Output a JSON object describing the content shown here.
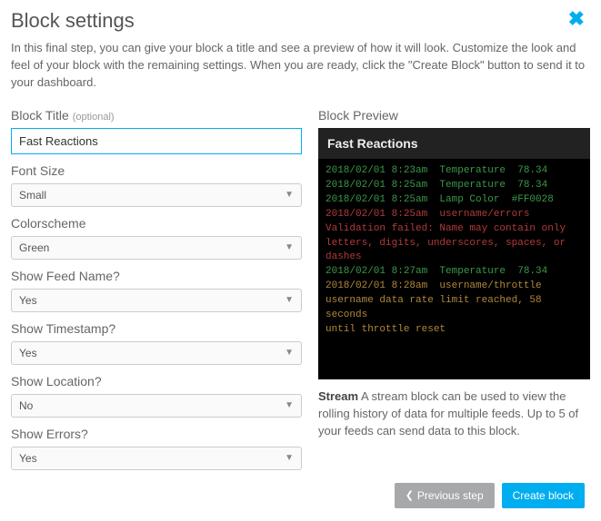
{
  "header": {
    "title": "Block settings",
    "description": "In this final step, you can give your block a title and see a preview of how it will look. Customize the look and feel of your block with the remaining settings. When you are ready, click the \"Create Block\" button to send it to your dashboard."
  },
  "form": {
    "blockTitle": {
      "label": "Block Title",
      "optional": "(optional)",
      "value": "Fast Reactions"
    },
    "fontSize": {
      "label": "Font Size",
      "value": "Small"
    },
    "colorscheme": {
      "label": "Colorscheme",
      "value": "Green"
    },
    "showFeedName": {
      "label": "Show Feed Name?",
      "value": "Yes"
    },
    "showTimestamp": {
      "label": "Show Timestamp?",
      "value": "Yes"
    },
    "showLocation": {
      "label": "Show Location?",
      "value": "No"
    },
    "showErrors": {
      "label": "Show Errors?",
      "value": "Yes"
    }
  },
  "preview": {
    "sectionTitle": "Block Preview",
    "blockTitle": "Fast Reactions",
    "lines": [
      {
        "text": "2018/02/01 8:23am  Temperature  78.34",
        "cls": "g"
      },
      {
        "text": "2018/02/01 8:25am  Temperature  78.34",
        "cls": "g"
      },
      {
        "text": "2018/02/01 8:25am  Lamp Color  #FF0028",
        "cls": "g"
      },
      {
        "text": "2018/02/01 8:25am  username/errors",
        "cls": "r"
      },
      {
        "text": "Validation failed: Name may contain only",
        "cls": "r"
      },
      {
        "text": "letters, digits, underscores, spaces, or dashes",
        "cls": "r"
      },
      {
        "text": "2018/02/01 8:27am  Temperature  78.34",
        "cls": "g"
      },
      {
        "text": "2018/02/01 8:28am  username/throttle",
        "cls": "y"
      },
      {
        "text": "username data rate limit reached, 58 seconds",
        "cls": "y"
      },
      {
        "text": "until throttle reset",
        "cls": "y"
      }
    ],
    "descTitle": "Stream",
    "descBody": "A stream block can be used to view the rolling history of data for multiple feeds. Up to 5 of your feeds can send data to this block."
  },
  "footer": {
    "prevLabel": "Previous step",
    "createLabel": "Create block"
  },
  "colors": {
    "accent": "#00aeef",
    "green": "#3a994a",
    "red": "#b43a3a",
    "yellow": "#b0893a"
  }
}
